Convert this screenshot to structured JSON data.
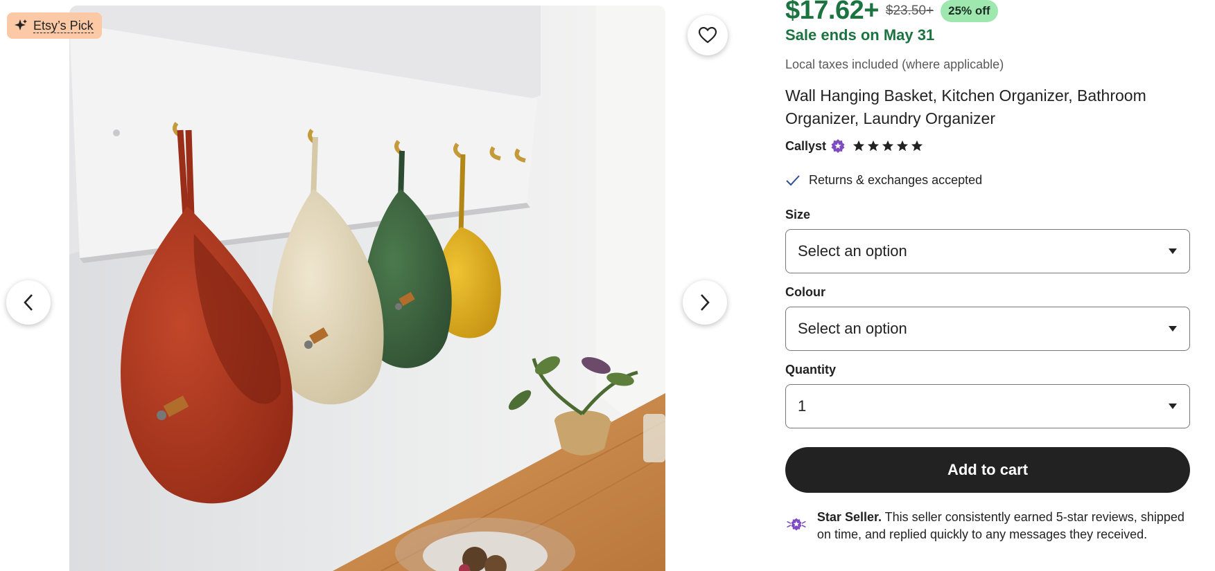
{
  "gallery": {
    "badge": "Etsy’s Pick",
    "icons": {
      "badge": "sparkle-icon",
      "favorite": "heart-icon",
      "prev": "chevron-left-icon",
      "next": "chevron-right-icon"
    },
    "colors": {
      "red_basket": "#b7381f",
      "cream_basket": "#e7dcc0",
      "green_basket": "#3e6540",
      "yellow_basket": "#e3b21c",
      "table": "#c8874a"
    }
  },
  "listing": {
    "price": "$17.62+",
    "original_price": "$23.50+",
    "discount": "25% off",
    "sale_note": "Sale ends on May 31",
    "taxes": "Local taxes included (where applicable)",
    "title": "Wall Hanging Basket, Kitchen Organizer, Bathroom Organizer, Laundry Organizer",
    "shop": {
      "name": "Callyst",
      "rating": 5,
      "badge_icon": "star-seller-badge-icon"
    },
    "returns": "Returns & exchanges accepted",
    "size": {
      "label": "Size",
      "value": "Select an option"
    },
    "colour": {
      "label": "Colour",
      "value": "Select an option"
    },
    "quantity": {
      "label": "Quantity",
      "value": "1"
    },
    "add_to_cart": "Add to cart",
    "star_seller": {
      "title": "Star Seller.",
      "text": "This seller consistently earned 5-star reviews, shipped on time, and replied quickly to any messages they received."
    }
  },
  "colors": {
    "sale_green": "#1b7340",
    "discount_bg": "#9ee8b0",
    "badge_bg": "#fbc9a6",
    "star_seller_purple": "#7e4cc0",
    "button_dark": "#222222"
  }
}
